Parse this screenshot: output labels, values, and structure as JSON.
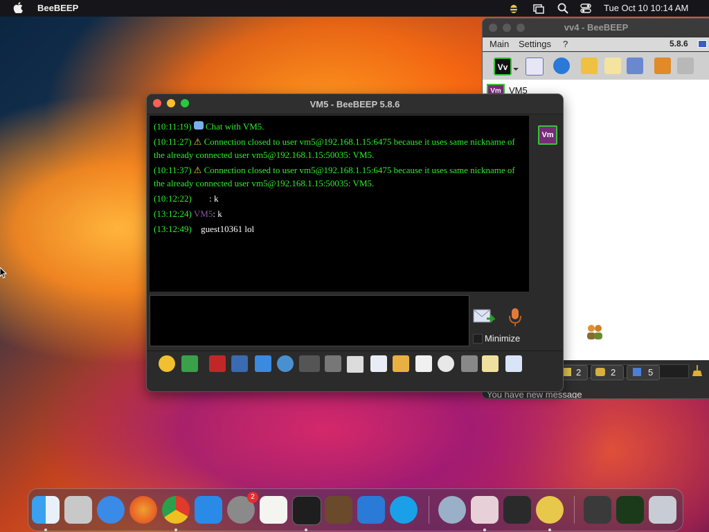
{
  "menubar": {
    "app_name": "BeeBEEP",
    "clock": "Tue Oct 10  10:14 AM",
    "icons": [
      "apple-icon",
      "beebeep-tray-icon",
      "screen-mirroring-icon",
      "search-icon",
      "control-center-icon"
    ]
  },
  "back_window": {
    "title": "vv4 - BeeBEEP",
    "version": "5.8.6",
    "menu": [
      "Main",
      "Settings",
      "?"
    ],
    "toolbar_icons": [
      "profile-vv-icon",
      "dropdown-arrow-icon",
      "edit-status-icon",
      "network-broadcast-icon",
      "envelope-icon",
      "write-message-icon",
      "network-icon",
      "share-files-icon",
      "trash-icon"
    ],
    "user_badge": "Vm",
    "user_name": "VM5",
    "counts": [
      "2",
      "2",
      "5"
    ],
    "status_text": "You have new message"
  },
  "chat_window": {
    "title": "VM5 - BeeBEEP 5.8.6",
    "user_badge": "Vm",
    "minimize_label": "Minimize",
    "messages": [
      {
        "ts": "(10:11:19)",
        "text": "Chat with VM5."
      },
      {
        "ts": "(10:11:27)",
        "text": "Connection closed to user vm5@192.168.1.15:6475 because it uses same nickname of the already connected user vm5@192.168.1.15:50035: VM5."
      },
      {
        "ts": "(10:11:37)",
        "text": "Connection closed to user vm5@192.168.1.15:6475 because it uses same nickname of the already connected user vm5@192.168.1.15:50035: VM5."
      },
      {
        "ts": "(10:12:22)",
        "sender": "",
        "text": ": k"
      },
      {
        "ts": "(13:12:24)",
        "sender": "VM5",
        "text": ": k"
      },
      {
        "ts": "(13:12:49)",
        "sender": "guest10361",
        "text": "lol"
      }
    ],
    "tool_icons": [
      "emoji-icon",
      "envelope-icon",
      "text-font-icon",
      "color-icon",
      "filter-icon",
      "settings-icon",
      "spellcheck-icon",
      "word-completer-icon",
      "mark-icon",
      "send-file-icon",
      "send-folder-icon",
      "code-icon",
      "screenshot-icon",
      "history-icon",
      "notes-icon",
      "save-icon"
    ]
  },
  "dock": {
    "apps": [
      "finder-icon",
      "launchpad-icon",
      "safari-icon",
      "firefox-icon",
      "chrome-icon",
      "app-store-icon",
      "system-settings-icon",
      "textedit-icon",
      "terminal-icon",
      "garageband-icon",
      "vscode-icon",
      "skype-icon",
      "quicktime-icon",
      "parallels-icon",
      "piano-icon",
      "beebeep-icon",
      "display-icon",
      "activity-monitor-icon",
      "trash-icon"
    ],
    "settings_badge": "2"
  },
  "colors": {
    "chat_text": "#2cf02c",
    "chat_bg": "#000000",
    "vm_badge_bg": "#7a2a7a",
    "vm_badge_border": "#38c438"
  }
}
